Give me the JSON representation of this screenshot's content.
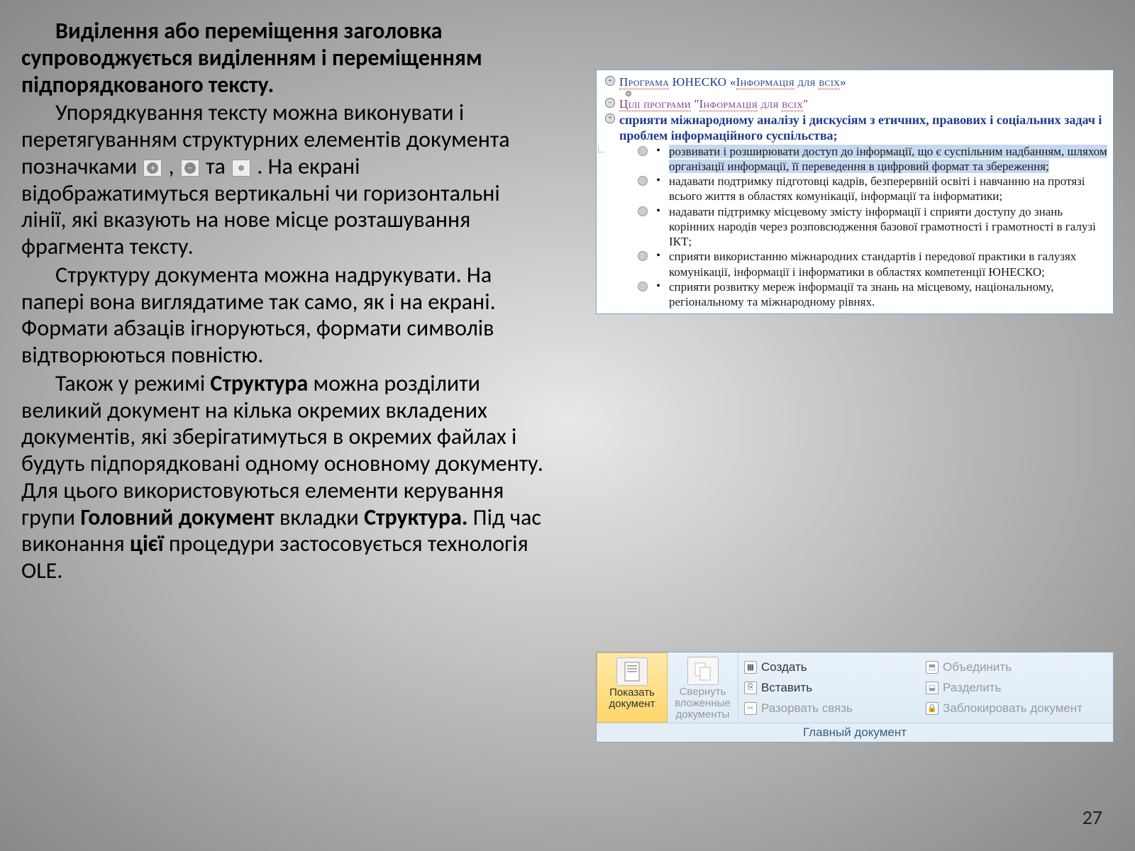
{
  "left": {
    "p1_bold": "Виділення або переміщення заголовка супроводжується виділенням і переміщенням підпорядкованого тексту.",
    "p2a": "Упорядкування тексту можна виконувати і перетягуванням структурних елементів документа позначками",
    "p2b": ",",
    "p2c": "та",
    "p2d": ". На екрані відображатимуться вертикальні чи горизонтальні лінії, які вказують на нове місце розташування фрагмента тексту.",
    "p3": "Структуру документа можна надрукувати. На папері вона виглядатиме так само, як і на екрані. Формати абзаців ігноруються, формати символів відтворюються повністю.",
    "p4a": "Також у режимі ",
    "p4b": "Структура",
    "p4c": " можна розділити великий документ на кілька окремих вкладених документів, які зберігатимуться в окремих файлах і будуть підпорядковані одному основному документу. Для цього використовуються елементи керування групи ",
    "p4d": "Головний документ",
    "p4e": " вкладки ",
    "p4f": "Структура.",
    "p4g": " Під час виконання ",
    "p4h": "цієї",
    "p4i": " процедури застосовується технологія OLE."
  },
  "outline": {
    "h1_a": "Програма",
    "h1_b": " ЮНЕСКО «",
    "h1_c": "Інформація",
    "h1_d": " для ",
    "h1_e": "всіх",
    "h1_f": "»",
    "h2_a": "Цілі програми",
    "h2_b": " \"",
    "h2_c": "Інформація",
    "h2_d": " для ",
    "h2_e": "всіх",
    "h2_f": "\"",
    "h3": "сприяти міжнародному аналізу і дискусіям з етичних, правових і соціальних задач і проблем інформаційного суспільства;",
    "b1": "розвивати і розширювати доступ до інформації, що є суспільним надбанням, шляхом організації информації, її переведення в цифровий формат та збереження;",
    "b2": "надавати подтримку підготовці кадрів, безперервній освіті і навчанню на протязі всього життя в областях комунікації, інформації та інформатики;",
    "b3": "надавати підтримку місцевому змісту інформації і сприяти доступу до знань корінних народів через розповсюдження базової грамотності і грамотності в галузі ІКТ;",
    "b4": "сприяти використанню міжнародних стандартів і передової практики в галузях комунікації, інформації і інформатики в областях компетенції ЮНЕСКО;",
    "b5": "сприяти розвитку мереж інформації та знань на місцевому, національному, регіональному та міжнародному рівнях."
  },
  "ribbon": {
    "btn1": "Показать документ",
    "btn2": "Свернуть вложенные документы",
    "items": {
      "create": "Создать",
      "merge": "Объединить",
      "insert": "Вставить",
      "split": "Разделить",
      "unlink": "Разорвать связь",
      "lock": "Заблокировать документ"
    },
    "footer": "Главный документ"
  },
  "page": "27"
}
